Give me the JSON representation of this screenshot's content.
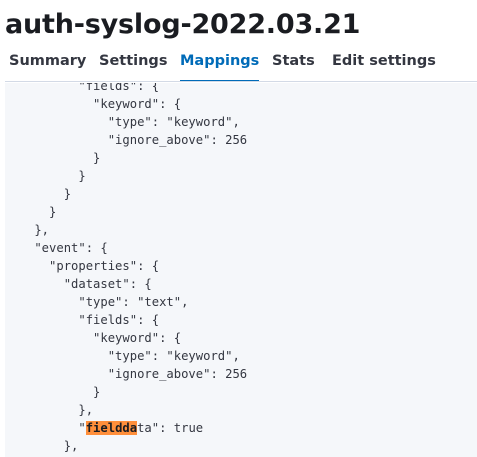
{
  "page": {
    "title": "auth-syslog-2022.03.21"
  },
  "tabs": [
    {
      "label": "Summary",
      "selected": false
    },
    {
      "label": "Settings",
      "selected": false
    },
    {
      "label": "Mappings",
      "selected": true
    },
    {
      "label": "Stats",
      "selected": false
    },
    {
      "label": "Edit settings",
      "selected": false
    }
  ],
  "mappings_json": {
    "lines": [
      "          \"fields\": {",
      "            \"keyword\": {",
      "              \"type\": \"keyword\",",
      "              \"ignore_above\": 256",
      "            }",
      "          }",
      "        }",
      "      }",
      "    },",
      "    \"event\": {",
      "      \"properties\": {",
      "        \"dataset\": {",
      "          \"type\": \"text\",",
      "          \"fields\": {",
      "            \"keyword\": {",
      "              \"type\": \"keyword\",",
      "              \"ignore_above\": 256",
      "            }",
      "          },",
      "          \"fielddata\": true",
      "        },"
    ],
    "search_highlight": {
      "line": 19,
      "term": "fieldda"
    }
  },
  "colors": {
    "accent": "#006bb8",
    "highlight": "#ff8f3b",
    "code_background": "#f5f7fa"
  }
}
